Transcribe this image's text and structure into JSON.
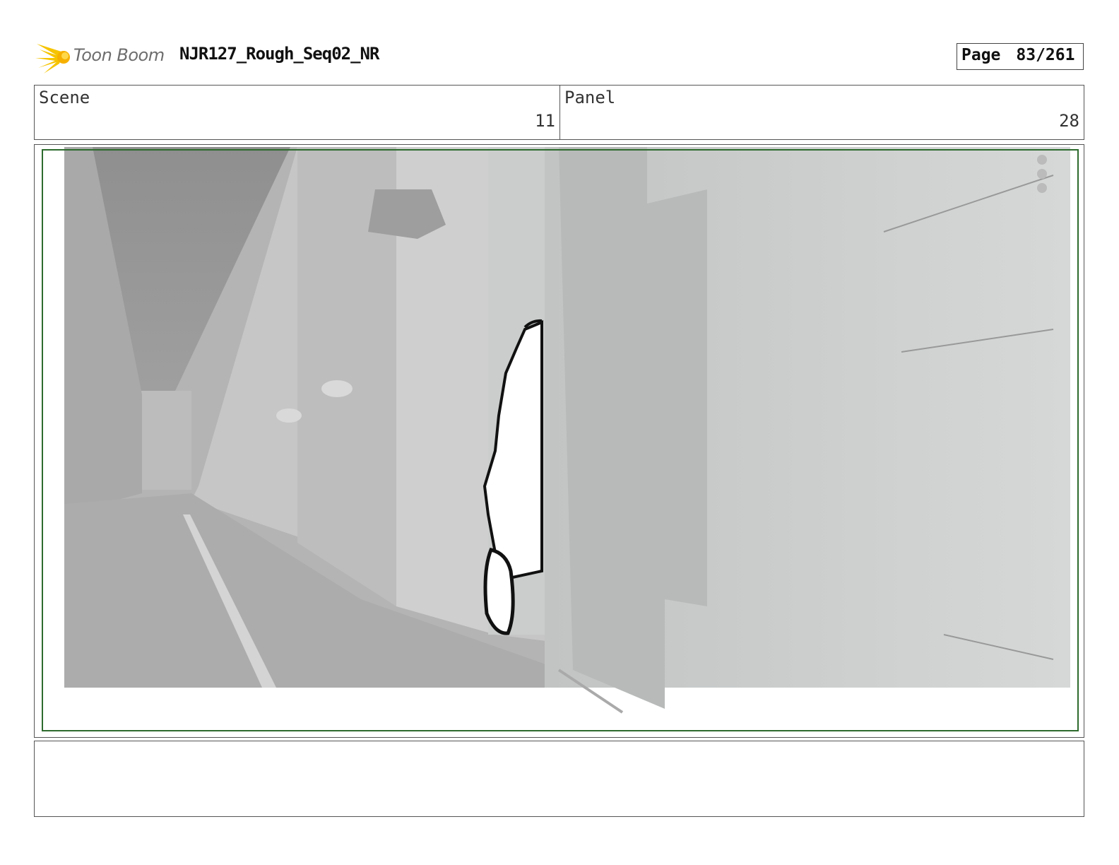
{
  "header": {
    "logo_text": "Toon Boom",
    "project_title": "NJR127_Rough_Seq02_NR",
    "page_label": "Page",
    "page_number": "83/261"
  },
  "fields": {
    "scene_label": "Scene",
    "scene_value": "11",
    "panel_label": "Panel",
    "panel_value": "28"
  },
  "panel_icons": [
    "hand-icon",
    "camera-icon",
    "grid-icon"
  ],
  "notes": {
    "text": ""
  },
  "colors": {
    "safe_frame": "#2e6b2e",
    "logo_yellow": "#f6c400",
    "logo_text": "#6d6d6d"
  }
}
